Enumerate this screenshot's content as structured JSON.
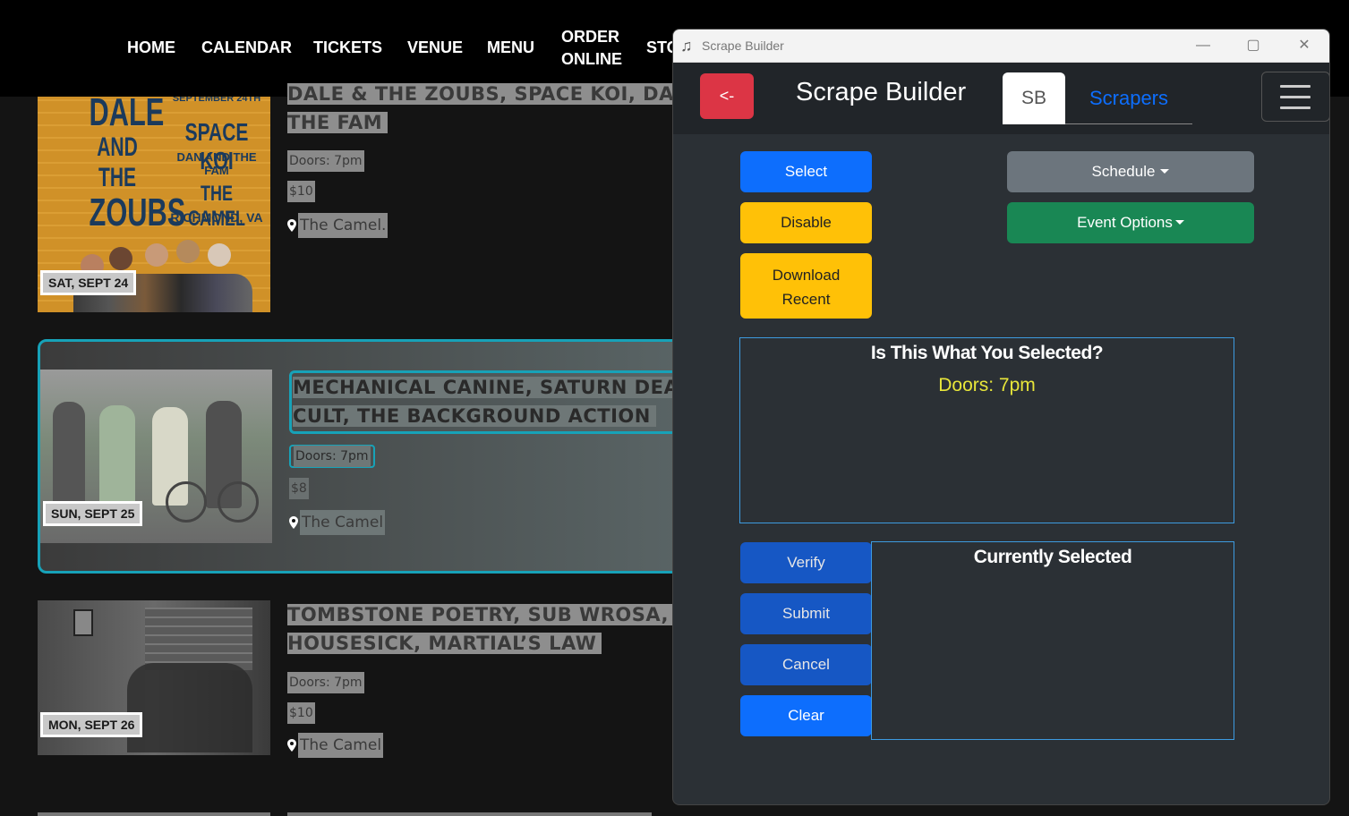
{
  "site": {
    "nav": [
      "HOME",
      "CALENDAR",
      "TICKETS",
      "VENUE",
      "MENU",
      "ORDER ONLINE",
      "STO"
    ],
    "poster": {
      "date_line": "SEPTEMBER 24TH",
      "act_line1": "DALE",
      "act_line2": "AND THE",
      "act_line3": "ZOUBS",
      "space_koi": "SPACE KOI",
      "dan_fam": "DAN AND THE FAM",
      "venue": "THE CAMEL",
      "city": "RICHMOND, VA"
    },
    "events": [
      {
        "title_line1": "DALE & THE ZOUBS, SPACE KOI, DAN",
        "title_line2": "THE FAM",
        "doors": "Doors: 7pm",
        "price": "$10",
        "venue": "The Camel.",
        "date": "SAT, SEPT 24"
      },
      {
        "title_line1": "MECHANICAL CANINE, SATURN DEA",
        "title_line2": "CULT, THE BACKGROUND ACTION",
        "doors": "Doors: 7pm",
        "price": "$8",
        "venue": "The Camel",
        "date": "SUN, SEPT 25"
      },
      {
        "title_line1": "TOMBSTONE POETRY, SUB WROSA,",
        "title_line2": "HOUSESICK, MARTIAL’S LAW",
        "doors": "Doors: 7pm",
        "price": "$10",
        "venue": "The Camel",
        "date": "MON, SEPT 26"
      }
    ]
  },
  "window": {
    "title": "Scrape Builder",
    "icon": "music-note-icon",
    "controls": [
      "minimize",
      "maximize",
      "close"
    ]
  },
  "app": {
    "back_label": "<-",
    "title": "Scrape Builder",
    "tabs": [
      "SB",
      "Scrapers"
    ],
    "active_tab": "SB",
    "buttons": {
      "select": "Select",
      "disable": "Disable",
      "download_recent_1": "Download",
      "download_recent_2": "Recent",
      "schedule": "Schedule",
      "event_options": "Event Options",
      "verify": "Verify",
      "submit": "Submit",
      "cancel": "Cancel",
      "clear": "Clear"
    },
    "preview": {
      "heading": "Is This What You Selected?",
      "value": "Doors: 7pm"
    },
    "current": {
      "heading": "Currently Selected"
    }
  },
  "colors": {
    "back": "#dc3545",
    "primary": "#0d6efd",
    "warning": "#ffc107",
    "secondary": "#6c757d",
    "success": "#198754",
    "highlight_border": "#17a2b8",
    "preview_text": "#e8e63a"
  }
}
